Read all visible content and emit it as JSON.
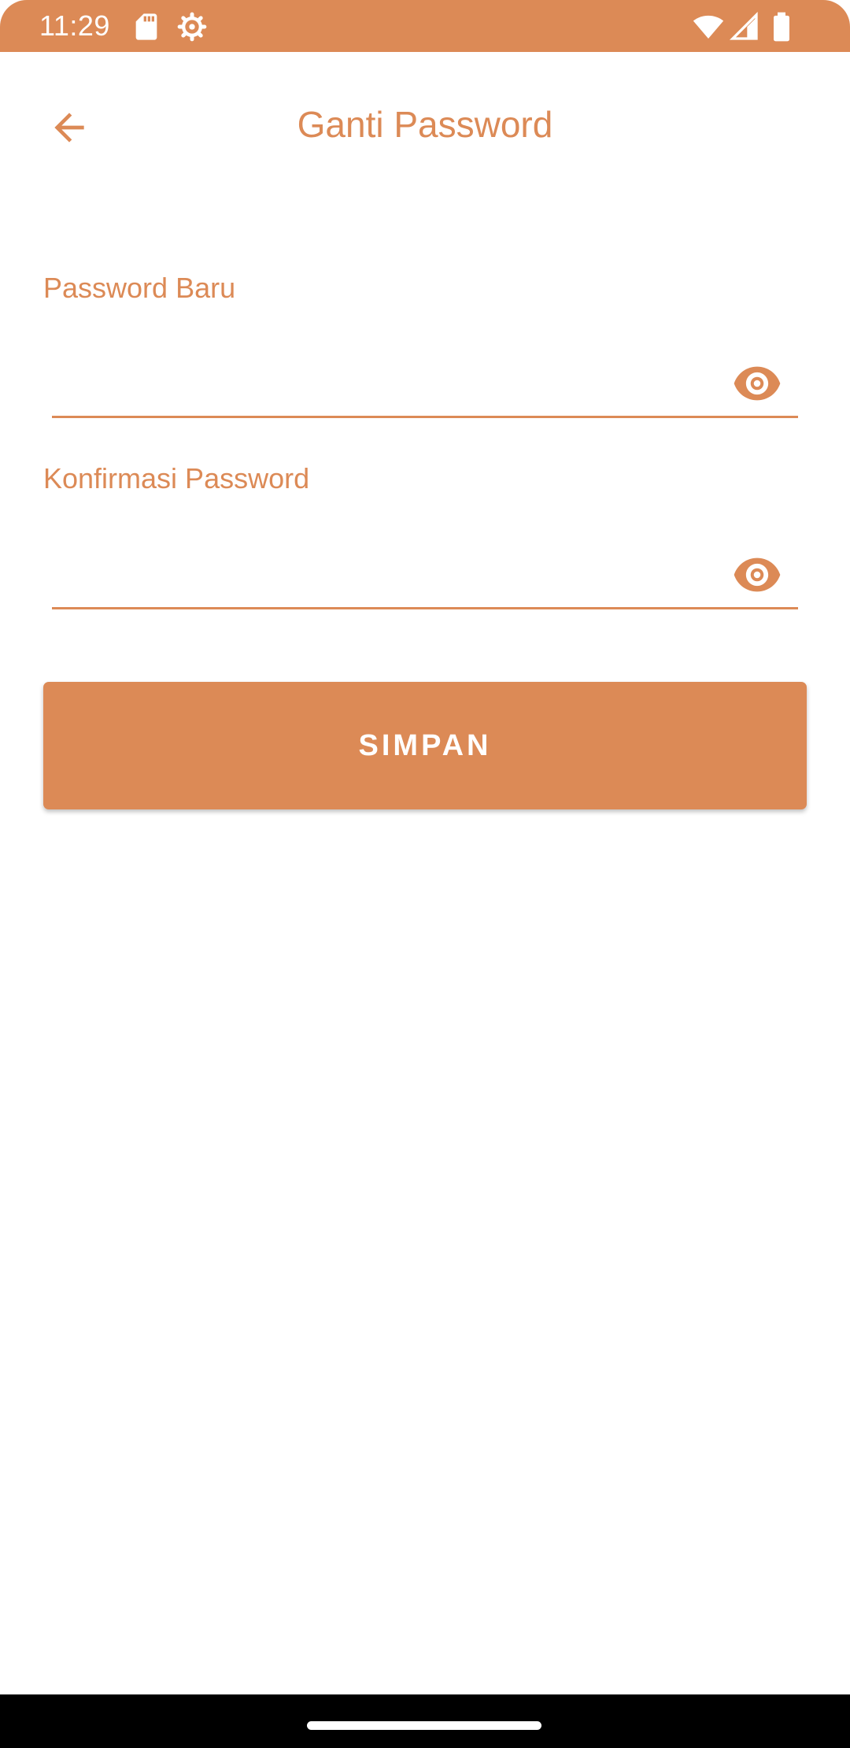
{
  "status_bar": {
    "time": "11:29",
    "icons": [
      "sd-card-icon",
      "settings-gear-icon",
      "wifi-icon",
      "signal-icon",
      "battery-icon"
    ]
  },
  "toolbar": {
    "back_icon": "arrow-back-icon",
    "title": "Ganti Password"
  },
  "form": {
    "new_password": {
      "label": "Password Baru",
      "value": "",
      "toggle_icon": "eye-icon"
    },
    "confirm_password": {
      "label": "Konfirmasi Password",
      "value": "",
      "toggle_icon": "eye-icon"
    },
    "save_label": "SIMPAN"
  },
  "colors": {
    "accent": "#dc8a56",
    "background": "#ffffff",
    "nav_bar": "#000000"
  }
}
